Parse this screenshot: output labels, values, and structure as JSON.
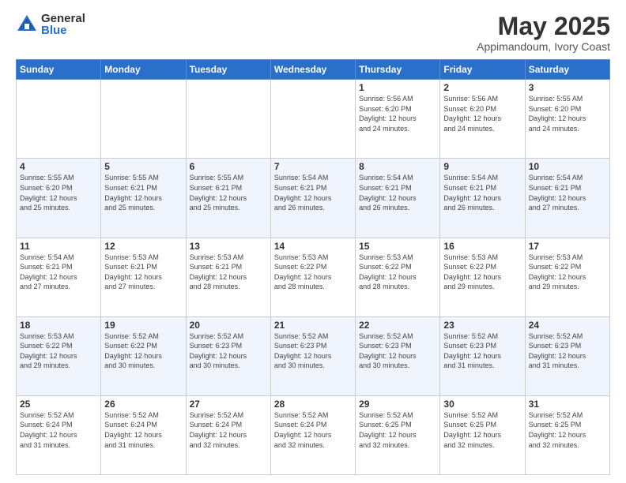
{
  "logo": {
    "general": "General",
    "blue": "Blue"
  },
  "title": {
    "month": "May 2025",
    "location": "Appimandoum, Ivory Coast"
  },
  "days_of_week": [
    "Sunday",
    "Monday",
    "Tuesday",
    "Wednesday",
    "Thursday",
    "Friday",
    "Saturday"
  ],
  "weeks": [
    [
      {
        "day": "",
        "info": ""
      },
      {
        "day": "",
        "info": ""
      },
      {
        "day": "",
        "info": ""
      },
      {
        "day": "",
        "info": ""
      },
      {
        "day": "1",
        "info": "Sunrise: 5:56 AM\nSunset: 6:20 PM\nDaylight: 12 hours\nand 24 minutes."
      },
      {
        "day": "2",
        "info": "Sunrise: 5:56 AM\nSunset: 6:20 PM\nDaylight: 12 hours\nand 24 minutes."
      },
      {
        "day": "3",
        "info": "Sunrise: 5:55 AM\nSunset: 6:20 PM\nDaylight: 12 hours\nand 24 minutes."
      }
    ],
    [
      {
        "day": "4",
        "info": "Sunrise: 5:55 AM\nSunset: 6:20 PM\nDaylight: 12 hours\nand 25 minutes."
      },
      {
        "day": "5",
        "info": "Sunrise: 5:55 AM\nSunset: 6:21 PM\nDaylight: 12 hours\nand 25 minutes."
      },
      {
        "day": "6",
        "info": "Sunrise: 5:55 AM\nSunset: 6:21 PM\nDaylight: 12 hours\nand 25 minutes."
      },
      {
        "day": "7",
        "info": "Sunrise: 5:54 AM\nSunset: 6:21 PM\nDaylight: 12 hours\nand 26 minutes."
      },
      {
        "day": "8",
        "info": "Sunrise: 5:54 AM\nSunset: 6:21 PM\nDaylight: 12 hours\nand 26 minutes."
      },
      {
        "day": "9",
        "info": "Sunrise: 5:54 AM\nSunset: 6:21 PM\nDaylight: 12 hours\nand 26 minutes."
      },
      {
        "day": "10",
        "info": "Sunrise: 5:54 AM\nSunset: 6:21 PM\nDaylight: 12 hours\nand 27 minutes."
      }
    ],
    [
      {
        "day": "11",
        "info": "Sunrise: 5:54 AM\nSunset: 6:21 PM\nDaylight: 12 hours\nand 27 minutes."
      },
      {
        "day": "12",
        "info": "Sunrise: 5:53 AM\nSunset: 6:21 PM\nDaylight: 12 hours\nand 27 minutes."
      },
      {
        "day": "13",
        "info": "Sunrise: 5:53 AM\nSunset: 6:21 PM\nDaylight: 12 hours\nand 28 minutes."
      },
      {
        "day": "14",
        "info": "Sunrise: 5:53 AM\nSunset: 6:22 PM\nDaylight: 12 hours\nand 28 minutes."
      },
      {
        "day": "15",
        "info": "Sunrise: 5:53 AM\nSunset: 6:22 PM\nDaylight: 12 hours\nand 28 minutes."
      },
      {
        "day": "16",
        "info": "Sunrise: 5:53 AM\nSunset: 6:22 PM\nDaylight: 12 hours\nand 29 minutes."
      },
      {
        "day": "17",
        "info": "Sunrise: 5:53 AM\nSunset: 6:22 PM\nDaylight: 12 hours\nand 29 minutes."
      }
    ],
    [
      {
        "day": "18",
        "info": "Sunrise: 5:53 AM\nSunset: 6:22 PM\nDaylight: 12 hours\nand 29 minutes."
      },
      {
        "day": "19",
        "info": "Sunrise: 5:52 AM\nSunset: 6:22 PM\nDaylight: 12 hours\nand 30 minutes."
      },
      {
        "day": "20",
        "info": "Sunrise: 5:52 AM\nSunset: 6:23 PM\nDaylight: 12 hours\nand 30 minutes."
      },
      {
        "day": "21",
        "info": "Sunrise: 5:52 AM\nSunset: 6:23 PM\nDaylight: 12 hours\nand 30 minutes."
      },
      {
        "day": "22",
        "info": "Sunrise: 5:52 AM\nSunset: 6:23 PM\nDaylight: 12 hours\nand 30 minutes."
      },
      {
        "day": "23",
        "info": "Sunrise: 5:52 AM\nSunset: 6:23 PM\nDaylight: 12 hours\nand 31 minutes."
      },
      {
        "day": "24",
        "info": "Sunrise: 5:52 AM\nSunset: 6:23 PM\nDaylight: 12 hours\nand 31 minutes."
      }
    ],
    [
      {
        "day": "25",
        "info": "Sunrise: 5:52 AM\nSunset: 6:24 PM\nDaylight: 12 hours\nand 31 minutes."
      },
      {
        "day": "26",
        "info": "Sunrise: 5:52 AM\nSunset: 6:24 PM\nDaylight: 12 hours\nand 31 minutes."
      },
      {
        "day": "27",
        "info": "Sunrise: 5:52 AM\nSunset: 6:24 PM\nDaylight: 12 hours\nand 32 minutes."
      },
      {
        "day": "28",
        "info": "Sunrise: 5:52 AM\nSunset: 6:24 PM\nDaylight: 12 hours\nand 32 minutes."
      },
      {
        "day": "29",
        "info": "Sunrise: 5:52 AM\nSunset: 6:25 PM\nDaylight: 12 hours\nand 32 minutes."
      },
      {
        "day": "30",
        "info": "Sunrise: 5:52 AM\nSunset: 6:25 PM\nDaylight: 12 hours\nand 32 minutes."
      },
      {
        "day": "31",
        "info": "Sunrise: 5:52 AM\nSunset: 6:25 PM\nDaylight: 12 hours\nand 32 minutes."
      }
    ]
  ]
}
